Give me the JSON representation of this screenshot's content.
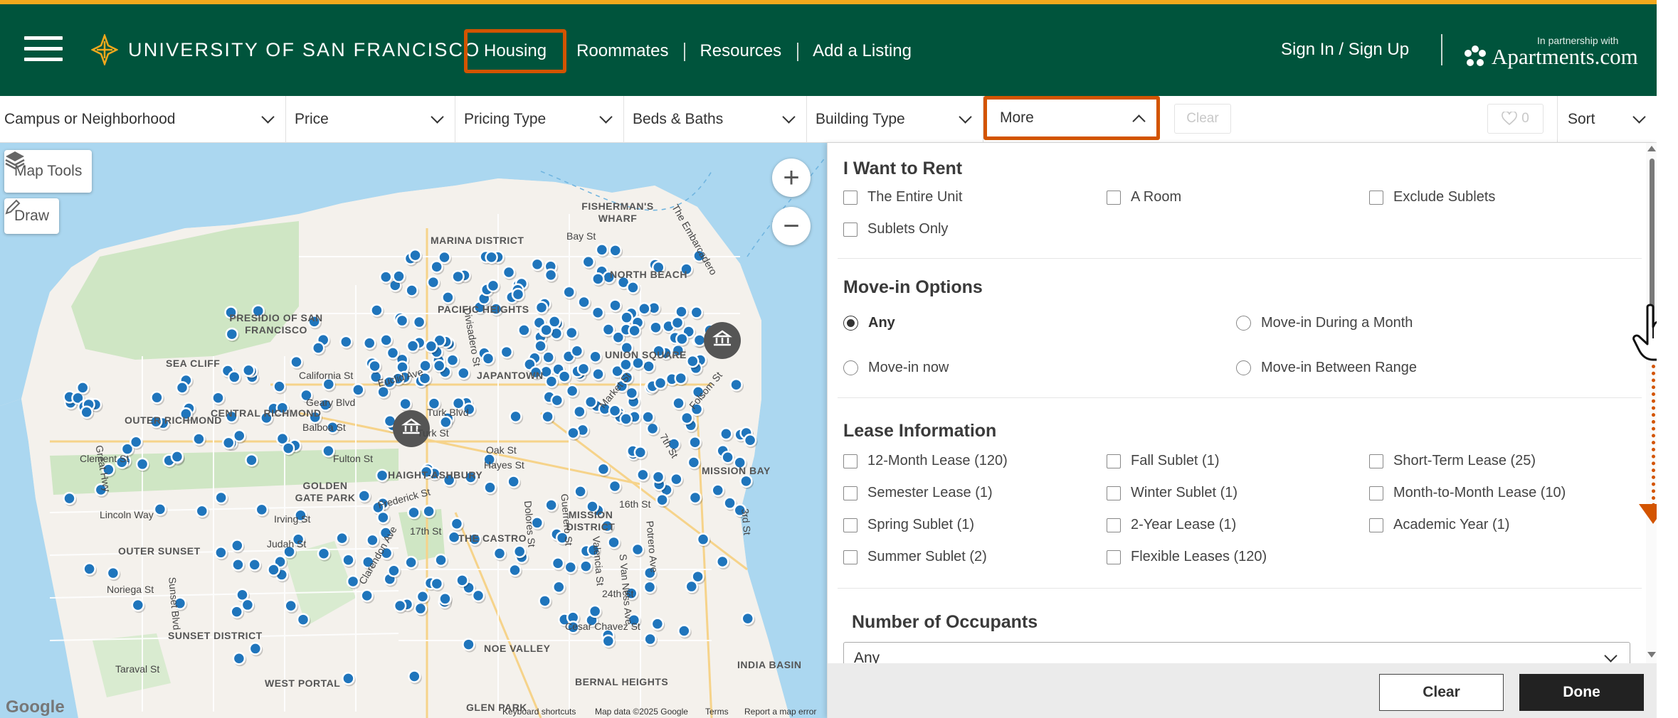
{
  "header": {
    "logo_text": "UNIVERSITY OF SAN FRANCISCO",
    "nav": [
      {
        "label": "Housing",
        "active": true
      },
      {
        "label": "Roommates"
      },
      {
        "label": "Resources"
      },
      {
        "label": "Add a Listing"
      }
    ],
    "signin_label": "Sign In / Sign Up",
    "partner_small": "In partnership with",
    "partner_name": "Apartments.com",
    "colors": {
      "brand_green": "#00543c",
      "accent_gold": "#f3a91c",
      "highlight_orange": "#d35400"
    }
  },
  "filters": {
    "items": [
      {
        "label": "Campus or Neighborhood"
      },
      {
        "label": "Price"
      },
      {
        "label": "Pricing Type"
      },
      {
        "label": "Beds & Baths"
      },
      {
        "label": "Building Type"
      },
      {
        "label": "More",
        "expanded": true
      }
    ],
    "clear_label": "Clear",
    "favorites_count": "0",
    "sort_label": "Sort"
  },
  "map": {
    "tools_label": "Map Tools",
    "draw_label": "Draw",
    "zoom_in": "+",
    "zoom_out": "−",
    "neighborhoods": [
      "FISHERMAN'S WHARF",
      "MARINA DISTRICT",
      "PACIFIC HEIGHTS",
      "NORTH BEACH",
      "PRESIDIO OF SAN FRANCISCO",
      "SEA CLIFF",
      "JAPANTOWN",
      "UNION SQUARE",
      "OUTER RICHMOND",
      "CENTRAL RICHMOND",
      "GOLDEN GATE PARK",
      "HAIGHT-ASHBURY",
      "MISSION BAY",
      "OUTER SUNSET",
      "MISSION DISTRICT",
      "NOE VALLEY",
      "SUNSET DISTRICT",
      "WEST PORTAL",
      "BERNAL HEIGHTS",
      "INDIA BASIN",
      "GLEN PARK",
      "THE CASTRO"
    ],
    "streets": [
      "The Embarcadero",
      "Bay St",
      "Divisadero St",
      "California St",
      "Euclid Ave",
      "Geary Blvd",
      "Turk Blvd",
      "Balboa St",
      "Fulton St",
      "Oak St",
      "Frederick St",
      "Irving St",
      "Lincoln Way",
      "Great Hwy",
      "Judah St",
      "Noriega St",
      "Sunset Blvd",
      "Taraval St",
      "17th St",
      "16th St",
      "24th St",
      "Cesar Chavez St",
      "Market St",
      "Folsom St",
      "7th St",
      "3rd St",
      "Dolores St",
      "Clarendon Ave",
      "Guerrero St",
      "Valencia St",
      "S Van Ness Ave",
      "Potrero Ave",
      "Clement St",
      "Turk St",
      "Hayes St"
    ],
    "google_label": "Google",
    "attribution": [
      "Keyboard shortcuts",
      "Map data ©2025 Google",
      "Terms",
      "Report a map error"
    ]
  },
  "panel": {
    "rent": {
      "title": "I Want to Rent",
      "options": [
        "The Entire Unit",
        "A Room",
        "Exclude Sublets",
        "Sublets Only"
      ]
    },
    "movein": {
      "title": "Move-in Options",
      "options": [
        "Any",
        "Move-in During a Month",
        "Move-in now",
        "Move-in Between Range"
      ],
      "selected": "Any"
    },
    "lease": {
      "title": "Lease Information",
      "options": [
        "12-Month Lease (120)",
        "Fall Sublet (1)",
        "Short-Term Lease (25)",
        "Semester Lease (1)",
        "Winter Sublet (1)",
        "Month-to-Month Lease (10)",
        "Spring Sublet (1)",
        "2-Year Lease (1)",
        "Academic Year (1)",
        "Summer Sublet (2)",
        "Flexible Leases (120)"
      ]
    },
    "occupants": {
      "title": "Number of Occupants",
      "value": "Any"
    },
    "clear_label": "Clear",
    "done_label": "Done"
  }
}
